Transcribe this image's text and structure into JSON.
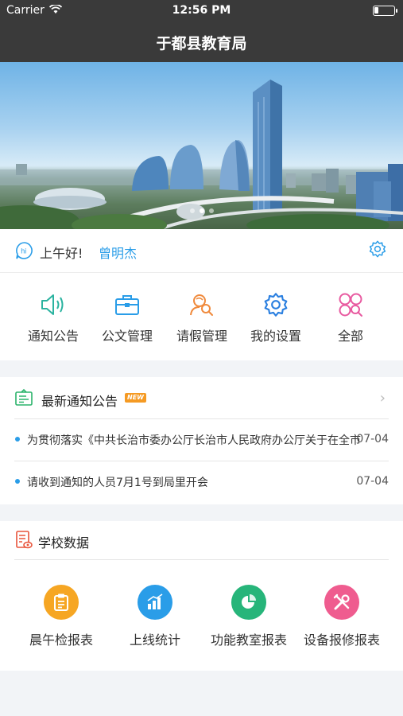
{
  "status_bar": {
    "carrier": "Carrier",
    "time": "12:56 PM",
    "battery_level": 0.2
  },
  "nav": {
    "title": "于都县教育局"
  },
  "banner": {
    "slide_count": 3,
    "active_slide": 2
  },
  "greeting": {
    "hello": "上午好!",
    "user_name": "曾明杰"
  },
  "quick_actions": [
    {
      "label": "通知公告",
      "icon": "speaker-icon",
      "color": "#2bb3a0"
    },
    {
      "label": "公文管理",
      "icon": "briefcase-icon",
      "color": "#2a9de8"
    },
    {
      "label": "请假管理",
      "icon": "person-search-icon",
      "color": "#f08a3c"
    },
    {
      "label": "我的设置",
      "icon": "gear-icon",
      "color": "#2a7fe0"
    },
    {
      "label": "全部",
      "icon": "grid-icon",
      "color": "#e85aa0"
    }
  ],
  "notices": {
    "title": "最新通知公告",
    "new_tag": "NEW",
    "items": [
      {
        "text": "为贯彻落实《中共长治市委办公厅长治市人民政府办公厅关于在全市",
        "date": "07-04"
      },
      {
        "text": "请收到通知的人员7月1号到局里开会",
        "date": "07-04"
      }
    ]
  },
  "school_data": {
    "title": "学校数据",
    "items": [
      {
        "label": "晨午检报表",
        "icon": "clipboard-icon",
        "color": "#f6a623"
      },
      {
        "label": "上线统计",
        "icon": "bar-chart-icon",
        "color": "#2a9de8"
      },
      {
        "label": "功能教室报表",
        "icon": "pie-chart-icon",
        "color": "#27b57a"
      },
      {
        "label": "设备报修报表",
        "icon": "tools-icon",
        "color": "#ef5c8f"
      }
    ]
  }
}
